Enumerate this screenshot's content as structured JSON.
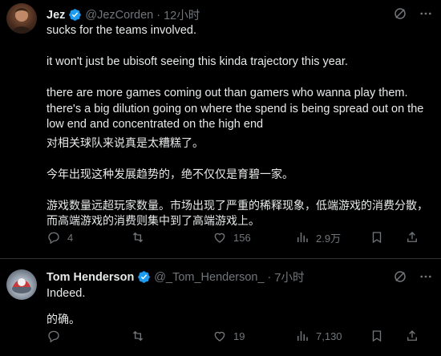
{
  "colors": {
    "background": "#000000",
    "text": "#e7e9ea",
    "muted": "#71767b",
    "verified": "#1d9bf0",
    "divider": "#2f3336"
  },
  "tweets": [
    {
      "author": {
        "name": "Jez",
        "handle": "@JezCorden",
        "verified": true,
        "avatar_icon": "profile-photo"
      },
      "separator": "·",
      "time": "12小时",
      "top_icons": [
        "grok-icon",
        "more-icon"
      ],
      "english_lines": [
        "sucks for the teams involved.",
        "",
        "it won't just be ubisoft seeing this kinda trajectory this year.",
        "",
        "there are more games coming out than gamers who wanna play them.",
        "there's a big dilution going on where the spend is being spread out on the",
        "low end and concentrated on the high end"
      ],
      "translation_lines": [
        "对相关球队来说真是太糟糕了。",
        "",
        "今年出现这种发展趋势的，绝不仅仅是育碧一家。",
        "",
        "游戏数量远超玩家数量。市场出现了严重的稀释现象，低端游戏的消费分散，",
        "而高端游戏的消费则集中到了高端游戏上。"
      ],
      "actions": {
        "reply": "4",
        "retweet": "",
        "like": "156",
        "views": "2.9万"
      }
    },
    {
      "author": {
        "name": "Tom Henderson",
        "handle": "@_Tom_Henderson_",
        "verified": true,
        "avatar_icon": "profile-photo"
      },
      "separator": "·",
      "time": "7小时",
      "top_icons": [
        "grok-icon",
        "more-icon"
      ],
      "english_lines": [
        "Indeed."
      ],
      "translation_lines": [
        "的确。"
      ],
      "actions": {
        "reply": "",
        "retweet": "",
        "like": "19",
        "views": "7,130"
      }
    }
  ]
}
